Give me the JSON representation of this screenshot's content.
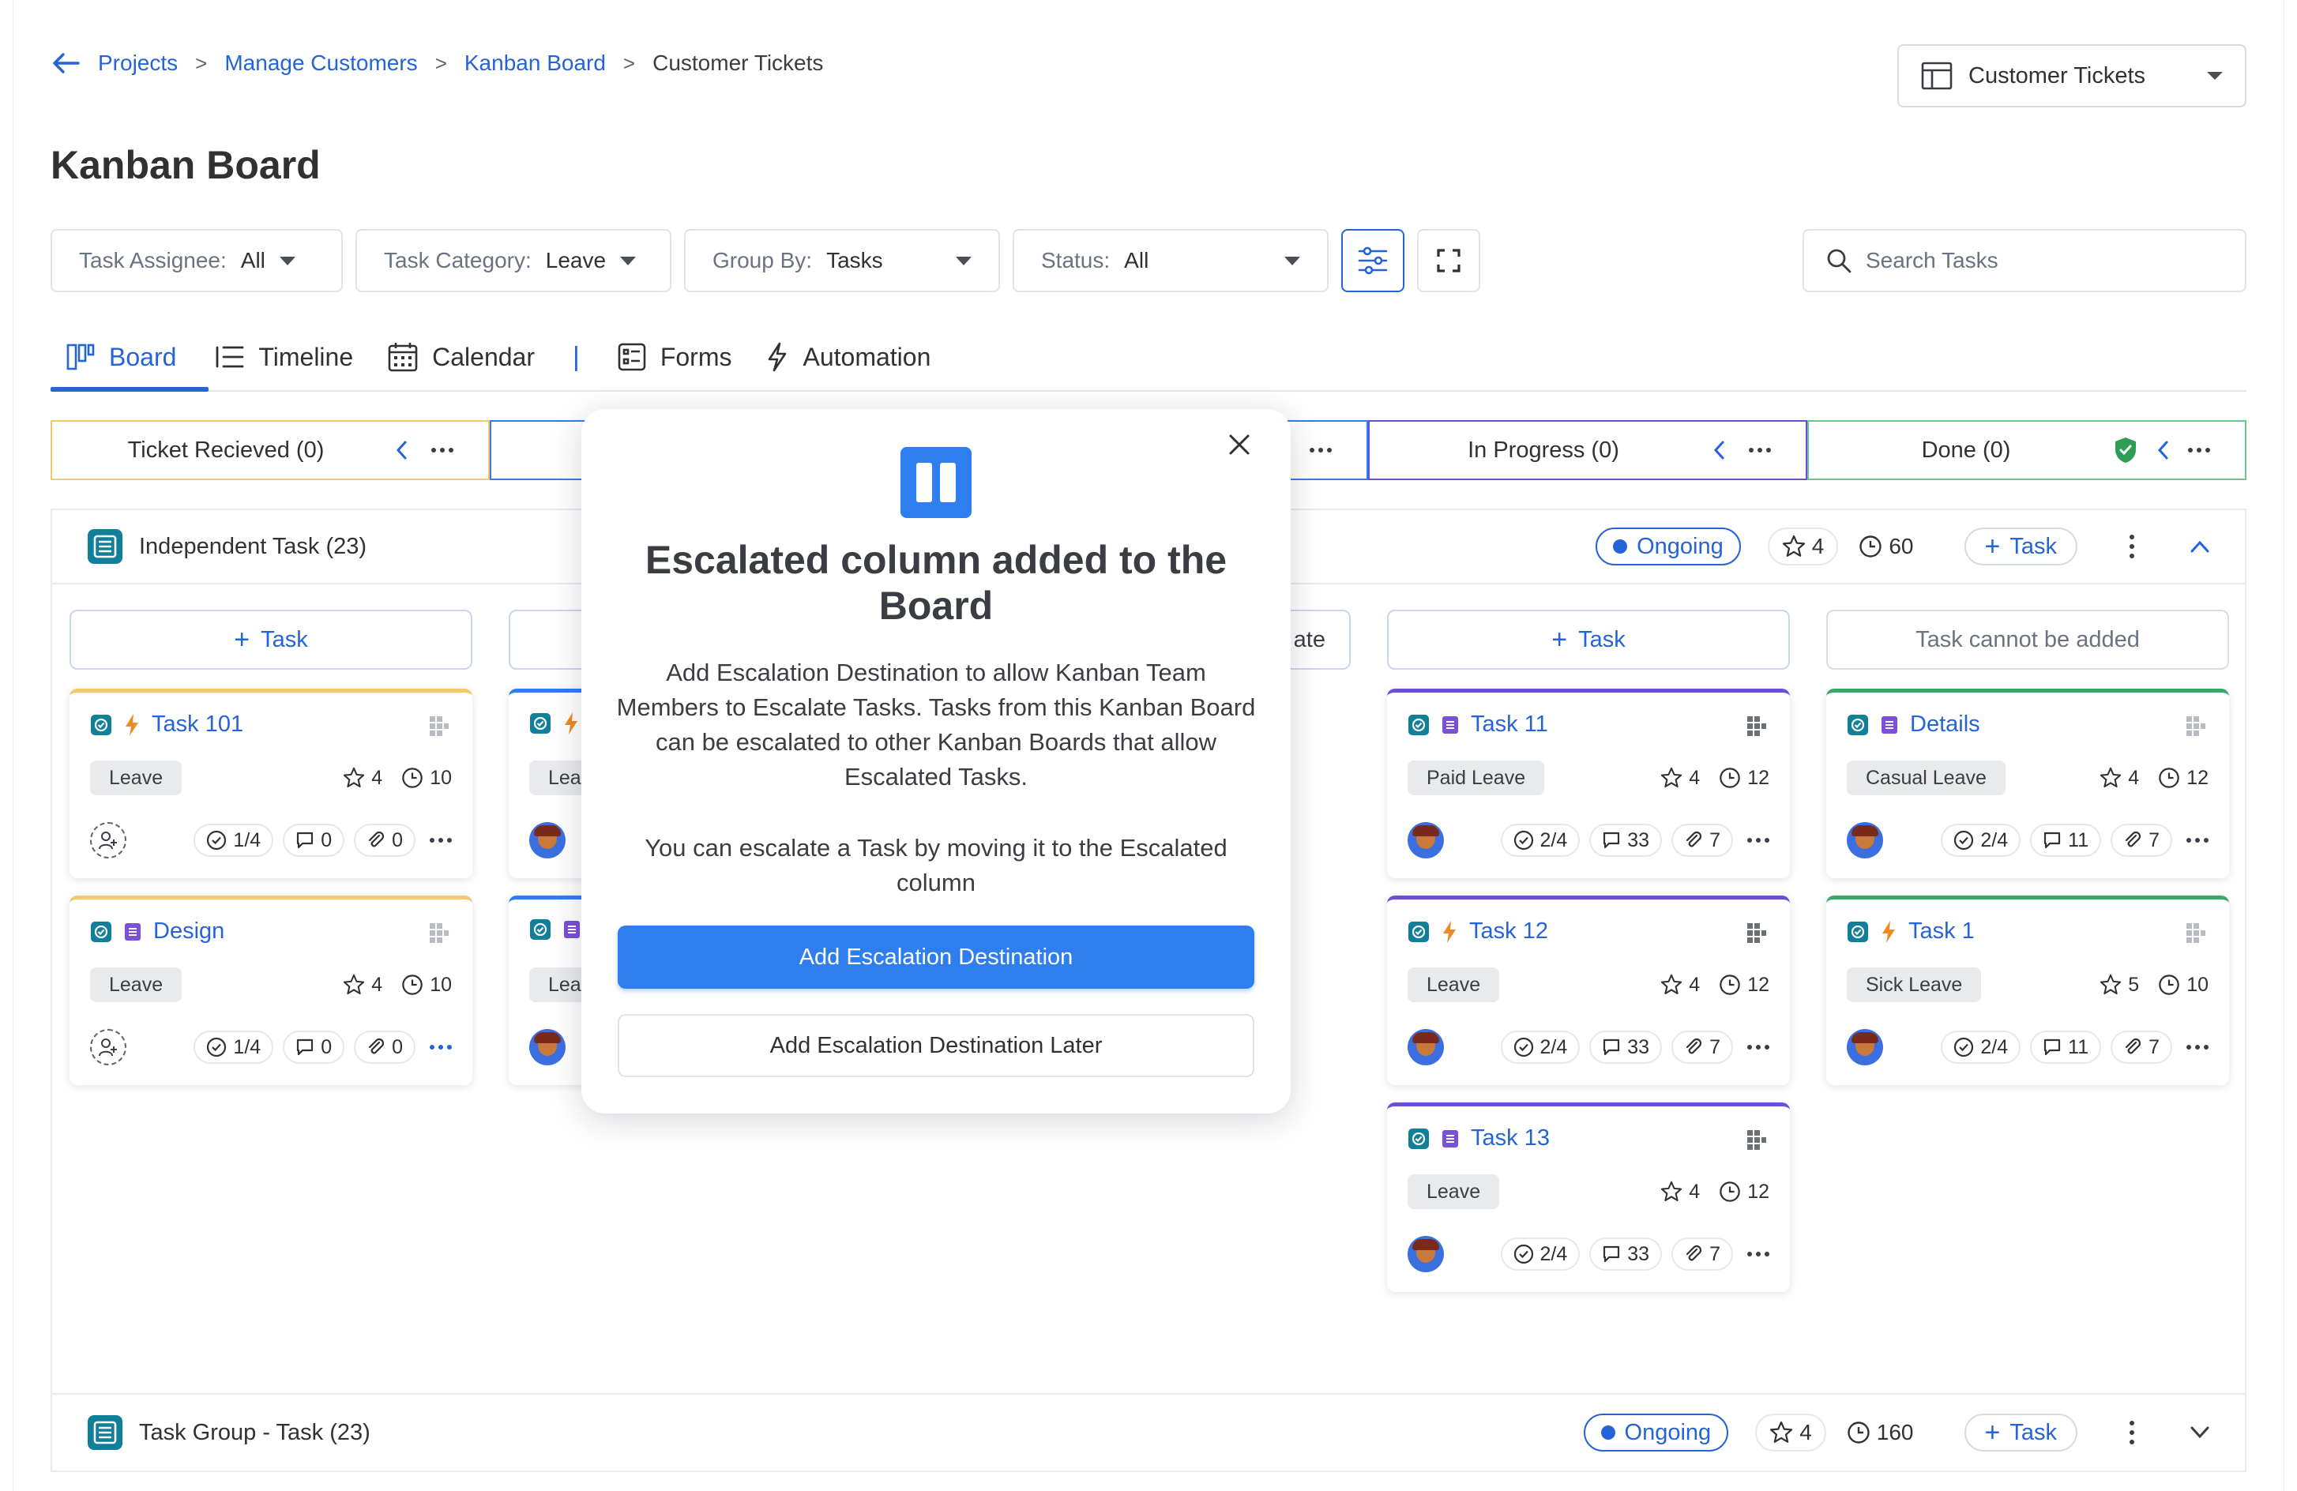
{
  "breadcrumb": {
    "items": [
      "Projects",
      "Manage Customers",
      "Kanban Board"
    ],
    "current": "Customer Tickets",
    "separator": ">"
  },
  "view_selector": {
    "label": "Customer Tickets"
  },
  "page_title": "Kanban Board",
  "filters": [
    {
      "label": "Task Assignee:",
      "value": "All"
    },
    {
      "label": "Task Category:",
      "value": "Leave"
    },
    {
      "label": "Group By:",
      "value": "Tasks"
    },
    {
      "label": "Status:",
      "value": "All"
    }
  ],
  "search": {
    "placeholder": "Search Tasks"
  },
  "tabs": [
    {
      "label": "Board",
      "icon": "board-icon",
      "active": true
    },
    {
      "label": "Timeline",
      "icon": "timeline-icon"
    },
    {
      "label": "Calendar",
      "icon": "calendar-icon"
    },
    {
      "label": "Forms",
      "icon": "forms-icon"
    },
    {
      "label": "Automation",
      "icon": "bolt-icon"
    }
  ],
  "tab_divider": "|",
  "columns": [
    {
      "name": "Ticket Recieved (0)",
      "color": "#f3c969"
    },
    {
      "name": "",
      "color": "#2f7ef0"
    },
    {
      "name": "",
      "color": "#2f7ef0"
    },
    {
      "name": "In Progress (0)",
      "color": "#6b4fd6"
    },
    {
      "name": "Done (0)",
      "color": "#6cc58a"
    }
  ],
  "groups": [
    {
      "name": "Independent Task (23)",
      "status": "Ongoing",
      "stars": "4",
      "time": "60",
      "add_label": "Task"
    },
    {
      "name": "Task Group - Task (23)",
      "status": "Ongoing",
      "stars": "4",
      "time": "160",
      "add_label": "Task"
    }
  ],
  "add_buttons": [
    "Task",
    "",
    "ate",
    "Task",
    "Task cannot be added"
  ],
  "cards": {
    "col1": [
      {
        "name": "Task 101",
        "tag": "Leave",
        "stars": "4",
        "time": "10",
        "checks": "1/4",
        "comments": "0",
        "attachments": "0"
      },
      {
        "name": "Design",
        "tag": "Leave",
        "stars": "4",
        "time": "10",
        "checks": "1/4",
        "comments": "0",
        "attachments": "0"
      }
    ],
    "col2": [
      {
        "tag": "Lea"
      },
      {
        "tag": "Lea"
      }
    ],
    "col4": [
      {
        "name": "Task 11",
        "tag": "Paid Leave",
        "stars": "4",
        "time": "12",
        "checks": "2/4",
        "comments": "33",
        "attachments": "7"
      },
      {
        "name": "Task 12",
        "tag": "Leave",
        "stars": "4",
        "time": "12",
        "checks": "2/4",
        "comments": "33",
        "attachments": "7"
      },
      {
        "name": "Task 13",
        "tag": "Leave",
        "stars": "4",
        "time": "12",
        "checks": "2/4",
        "comments": "33",
        "attachments": "7"
      }
    ],
    "col5": [
      {
        "name": "Details",
        "tag": "Casual Leave",
        "stars": "4",
        "time": "12",
        "checks": "2/4",
        "comments": "11",
        "attachments": "7"
      },
      {
        "name": "Task 1",
        "tag": "Sick Leave",
        "stars": "5",
        "time": "10",
        "checks": "2/4",
        "comments": "11",
        "attachments": "7"
      }
    ]
  },
  "modal": {
    "title": "Escalated column added to the Board",
    "description": "Add Escalation Destination to allow Kanban Team Members to Escalate Tasks. Tasks from this Kanban Board can be escalated to other Kanban Boards that allow Escalated Tasks.",
    "description2": "You can escalate a Task by moving it to the Escalated column",
    "primary_label": "Add Escalation Destination",
    "secondary_label": "Add Escalation Destination Later"
  },
  "colors": {
    "accent": "#2563d9",
    "primary_button": "#2f7ef0",
    "done_shield": "#2e9e56"
  }
}
